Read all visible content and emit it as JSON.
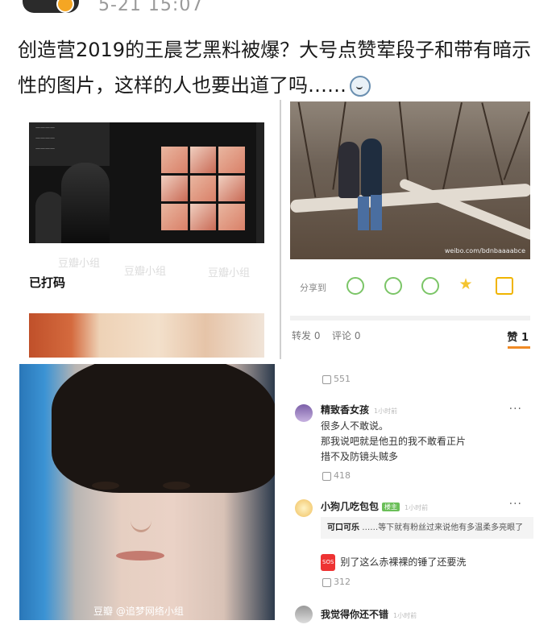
{
  "header": {
    "timestamp": "5-21 15:07",
    "headline": "创造营2019的王晨艺黑料被爆？大号点赞荤段子和带有暗示性的图片，这样的人也要出道了吗……"
  },
  "left_panel": {
    "masked_label": "已打码",
    "watermarks": [
      "豆瓣小组",
      "豆瓣小组",
      "豆瓣小组"
    ]
  },
  "right_panel": {
    "photo_watermark": "weibo.com/bdnbaaaabce",
    "share_label": "分享到",
    "share_icons": [
      "wechat-icon",
      "moments-icon",
      "qq-icon",
      "favorite-star-icon",
      "bookmark-icon"
    ],
    "repost": "转发 0",
    "comment": "评论 0",
    "likes": "赞 1"
  },
  "face_photo": {
    "watermark": "豆瓣 @追梦网络小组"
  },
  "comments": {
    "top_likes": "551",
    "items": [
      {
        "name": "精致香女孩",
        "time": "1小时前",
        "lines": [
          "很多人不敢说。",
          "那我说吧就是他丑的我不敢看正片",
          "措不及防镜头贼多"
        ],
        "likes": "418"
      },
      {
        "name": "小狗几吃包包",
        "tag": "楼主",
        "time": "1小时前",
        "reply_author": "可口可乐",
        "reply_text": "……等下就有粉丝过来说他有多温柔多亮眼了",
        "text": "别了这么赤裸裸的锤了还要洗",
        "likes": "312"
      },
      {
        "name": "我觉得你还不错",
        "time": "1小时前"
      }
    ],
    "more_label": "···"
  },
  "colors": {
    "accent_orange": "#f08a24",
    "share_green": "#7bc567",
    "fan_tag_green": "#6bbf59"
  }
}
